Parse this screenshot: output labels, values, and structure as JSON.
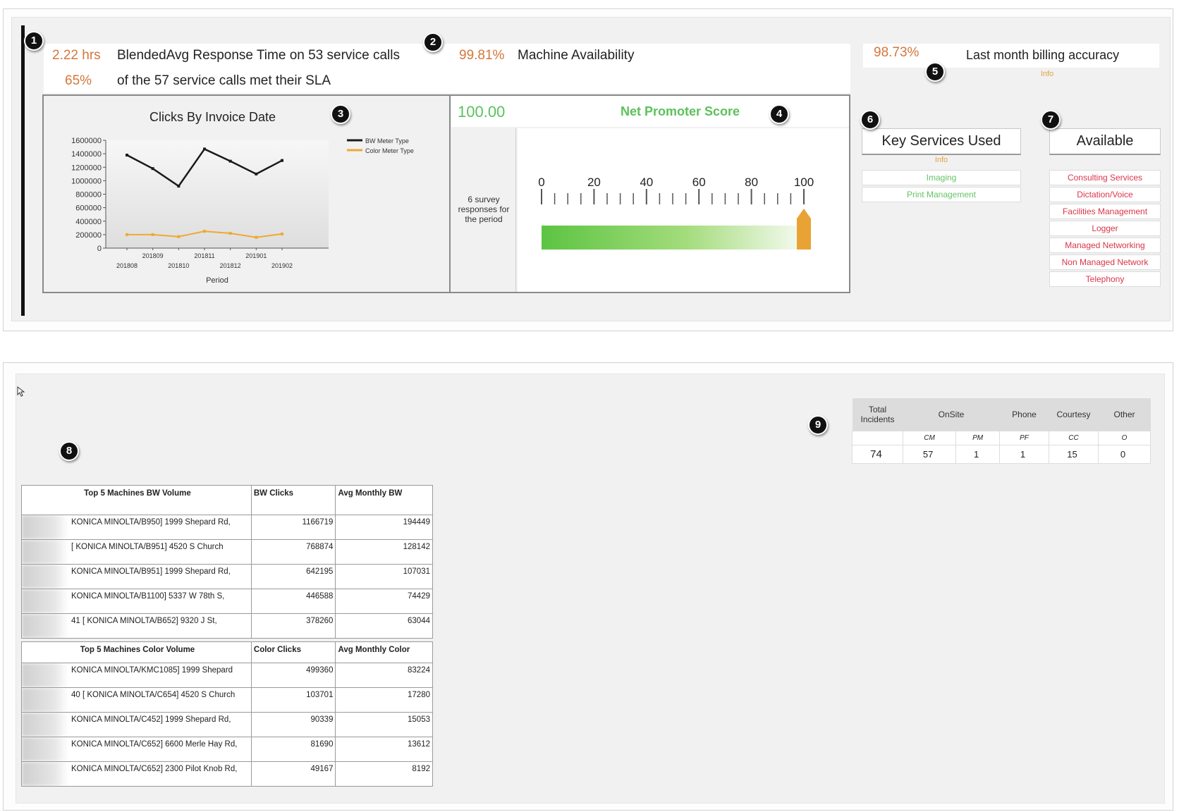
{
  "kpis": {
    "response_time_value": "2.22 hrs",
    "response_time_label": "BlendedAvg Response Time on 53 service calls",
    "sla_value": "65%",
    "sla_label": "of the 57 service calls met their SLA",
    "availability_value": "99.81%",
    "availability_label": "Machine Availability",
    "billing_value": "98.73%",
    "billing_label": "Last month billing accuracy",
    "billing_info": "Info"
  },
  "badges": [
    "1",
    "2",
    "3",
    "4",
    "5",
    "6",
    "7",
    "8",
    "9"
  ],
  "clicks_chart": {
    "title": "Clicks By Invoice Date",
    "xlabel": "Period",
    "legend": [
      "BW Meter Type",
      "Color Meter Type"
    ],
    "y_ticks": [
      "1600000",
      "1400000",
      "1200000",
      "1000000",
      "800000",
      "600000",
      "400000",
      "200000",
      "0"
    ],
    "x_ticks_upper": [
      "201809",
      "201811",
      "201901"
    ],
    "x_ticks_lower": [
      "201808",
      "201810",
      "201812",
      "201902"
    ]
  },
  "chart_data": {
    "type": "line",
    "title": "Clicks By Invoice Date",
    "xlabel": "Period",
    "ylabel": "",
    "x": [
      "201808",
      "201809",
      "201810",
      "201811",
      "201812",
      "201901",
      "201902"
    ],
    "ylim": [
      0,
      1600000
    ],
    "legend": "top-right",
    "grid": false,
    "series": [
      {
        "name": "BW Meter Type",
        "color": "#1a1a1a",
        "values": [
          1380000,
          1180000,
          920000,
          1470000,
          1290000,
          1100000,
          1300000
        ]
      },
      {
        "name": "Color Meter Type",
        "color": "#f0a830",
        "values": [
          200000,
          200000,
          170000,
          250000,
          220000,
          160000,
          210000
        ]
      }
    ]
  },
  "nps": {
    "value": "100.00",
    "label": "Net Promoter Score",
    "survey_note": "6 survey responses for the period",
    "scale_labels": [
      "0",
      "20",
      "40",
      "60",
      "80",
      "100"
    ],
    "score_fraction": 1.0
  },
  "key_services": {
    "title": "Key Services Used",
    "info": "Info",
    "items": [
      "Imaging",
      "Print Management"
    ]
  },
  "available": {
    "title": "Available",
    "items": [
      "Consulting Services",
      "Dictation/Voice",
      "Facilities Management",
      "Logger",
      "Managed Networking",
      "Non Managed Network",
      "Telephony"
    ]
  },
  "bw_table": {
    "headers": [
      "Top 5 Machines BW Volume",
      "BW Clicks",
      "Avg Monthly BW"
    ],
    "rows": [
      {
        "machine": "KONICA MINOLTA/B950] 1999 Shepard Rd,",
        "clicks": "1166719",
        "avg": "194449"
      },
      {
        "machine": "[ KONICA MINOLTA/B951] 4520 S Church",
        "clicks": "768874",
        "avg": "128142"
      },
      {
        "machine": "KONICA MINOLTA/B951] 1999 Shepard Rd,",
        "clicks": "642195",
        "avg": "107031"
      },
      {
        "machine": "KONICA MINOLTA/B1100] 5337 W 78th S,",
        "clicks": "446588",
        "avg": "74429"
      },
      {
        "machine": "41 [ KONICA MINOLTA/B652] 9320 J St,",
        "clicks": "378260",
        "avg": "63044"
      }
    ]
  },
  "color_table": {
    "headers": [
      "Top 5 Machines Color Volume",
      "Color Clicks",
      "Avg Monthly Color"
    ],
    "rows": [
      {
        "machine": "KONICA MINOLTA/KMC1085] 1999 Shepard",
        "clicks": "499360",
        "avg": "83224"
      },
      {
        "machine": "40 [ KONICA MINOLTA/C654] 4520 S Church",
        "clicks": "103701",
        "avg": "17280"
      },
      {
        "machine": "KONICA MINOLTA/C452] 1999 Shepard Rd,",
        "clicks": "90339",
        "avg": "15053"
      },
      {
        "machine": "KONICA MINOLTA/C652] 6600 Merle Hay Rd,",
        "clicks": "81690",
        "avg": "13612"
      },
      {
        "machine": "KONICA MINOLTA/C652] 2300 Pilot Knob Rd,",
        "clicks": "49167",
        "avg": "8192"
      }
    ]
  },
  "incidents": {
    "headers": [
      "Total Incidents",
      "OnSite",
      "Phone",
      "Courtesy",
      "Other"
    ],
    "subheaders": [
      "",
      "CM",
      "PM",
      "PF",
      "CC",
      "O"
    ],
    "values": [
      "74",
      "57",
      "1",
      "1",
      "15",
      "0"
    ]
  }
}
